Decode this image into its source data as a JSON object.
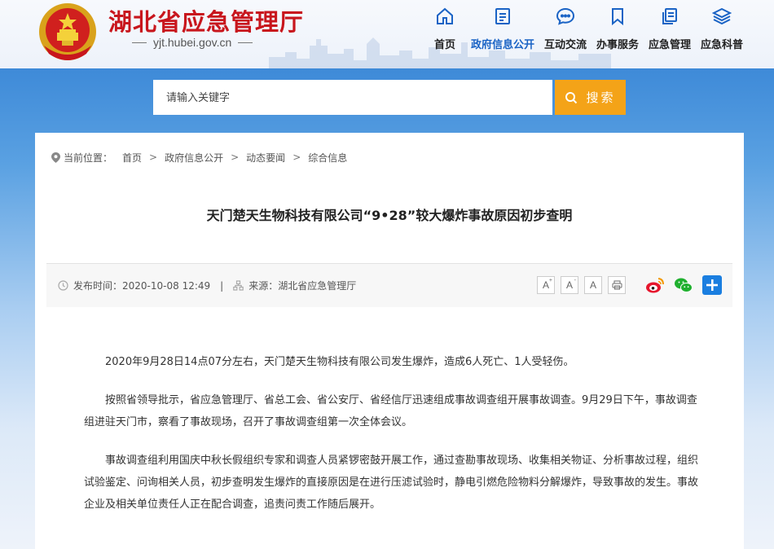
{
  "header": {
    "site_title": "湖北省应急管理厅",
    "site_domain": "yjt.hubei.gov.cn"
  },
  "nav": {
    "items": [
      {
        "label": "首页",
        "icon": "home-icon"
      },
      {
        "label": "政府信息公开",
        "icon": "document-icon",
        "active": true
      },
      {
        "label": "互动交流",
        "icon": "chat-icon"
      },
      {
        "label": "办事服务",
        "icon": "bookmark-icon"
      },
      {
        "label": "应急管理",
        "icon": "list-icon"
      },
      {
        "label": "应急科普",
        "icon": "layers-icon"
      }
    ]
  },
  "search": {
    "placeholder": "请输入关键字",
    "button_label": "搜索"
  },
  "breadcrumb": {
    "label": "当前位置：",
    "items": [
      "首页",
      "政府信息公开",
      "动态要闻",
      "综合信息"
    ]
  },
  "article": {
    "title": "天门楚天生物科技有限公司“9•28”较大爆炸事故原因初步查明",
    "publish_label": "发布时间：",
    "publish_time": "2020-10-08 12:49",
    "source_label": "来源：",
    "source": "湖北省应急管理厅",
    "paragraphs": [
      "2020年9月28日14点07分左右，天门楚天生物科技有限公司发生爆炸，造成6人死亡、1人受轻伤。",
      "按照省领导批示，省应急管理厅、省总工会、省公安厅、省经信厅迅速组成事故调查组开展事故调查。9月29日下午，事故调查组进驻天门市，察看了事故现场，召开了事故调查组第一次全体会议。",
      "事故调查组利用国庆中秋长假组织专家和调查人员紧锣密鼓开展工作，通过查勘事故现场、收集相关物证、分析事故过程，组织试验鉴定、问询相关人员，初步查明发生爆炸的直接原因是在进行压滤试验时，静电引燃危险物料分解爆炸，导致事故的发生。事故企业及相关单位责任人正在配合调查，追责问责工作随后展开。"
    ]
  },
  "tools": {
    "font_large": "A",
    "font_medium": "A",
    "font_small": "A",
    "plus_symbol": "+"
  },
  "colors": {
    "title_red": "#c8161d",
    "nav_active_blue": "#1a63c5",
    "search_orange": "#f4a318",
    "share_blue": "#1a7ee0"
  }
}
